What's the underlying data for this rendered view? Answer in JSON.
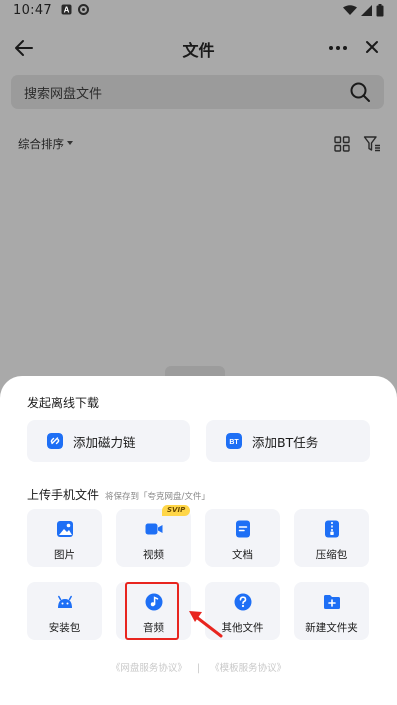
{
  "status_bar": {
    "time": "10:47"
  },
  "header": {
    "title": "文件"
  },
  "search": {
    "placeholder": "搜索网盘文件"
  },
  "sort": {
    "label": "综合排序"
  },
  "sheet": {
    "offline_title": "发起离线下载",
    "offline_buttons": [
      {
        "label": "添加磁力链",
        "icon": "magnet-link-icon"
      },
      {
        "label": "添加BT任务",
        "icon": "bt-task-icon"
      }
    ],
    "upload_title": "上传手机文件",
    "upload_subtitle": "将保存到「夸克网盘/文件」",
    "upload_items": [
      {
        "label": "图片",
        "icon": "image-icon"
      },
      {
        "label": "视频",
        "icon": "video-icon",
        "badge": "SVIP"
      },
      {
        "label": "文档",
        "icon": "document-icon"
      },
      {
        "label": "压缩包",
        "icon": "zip-icon"
      },
      {
        "label": "安装包",
        "icon": "android-icon"
      },
      {
        "label": "音频",
        "icon": "music-icon"
      },
      {
        "label": "其他文件",
        "icon": "question-icon"
      },
      {
        "label": "新建文件夹",
        "icon": "new-folder-icon"
      }
    ],
    "footer": {
      "terms": "《网盘服务协议》",
      "sep": "|",
      "other": "《模板服务协议》"
    }
  },
  "colors": {
    "accent": "#1e6ff5",
    "highlight": "#e8251f",
    "badge": "#ffd648"
  }
}
